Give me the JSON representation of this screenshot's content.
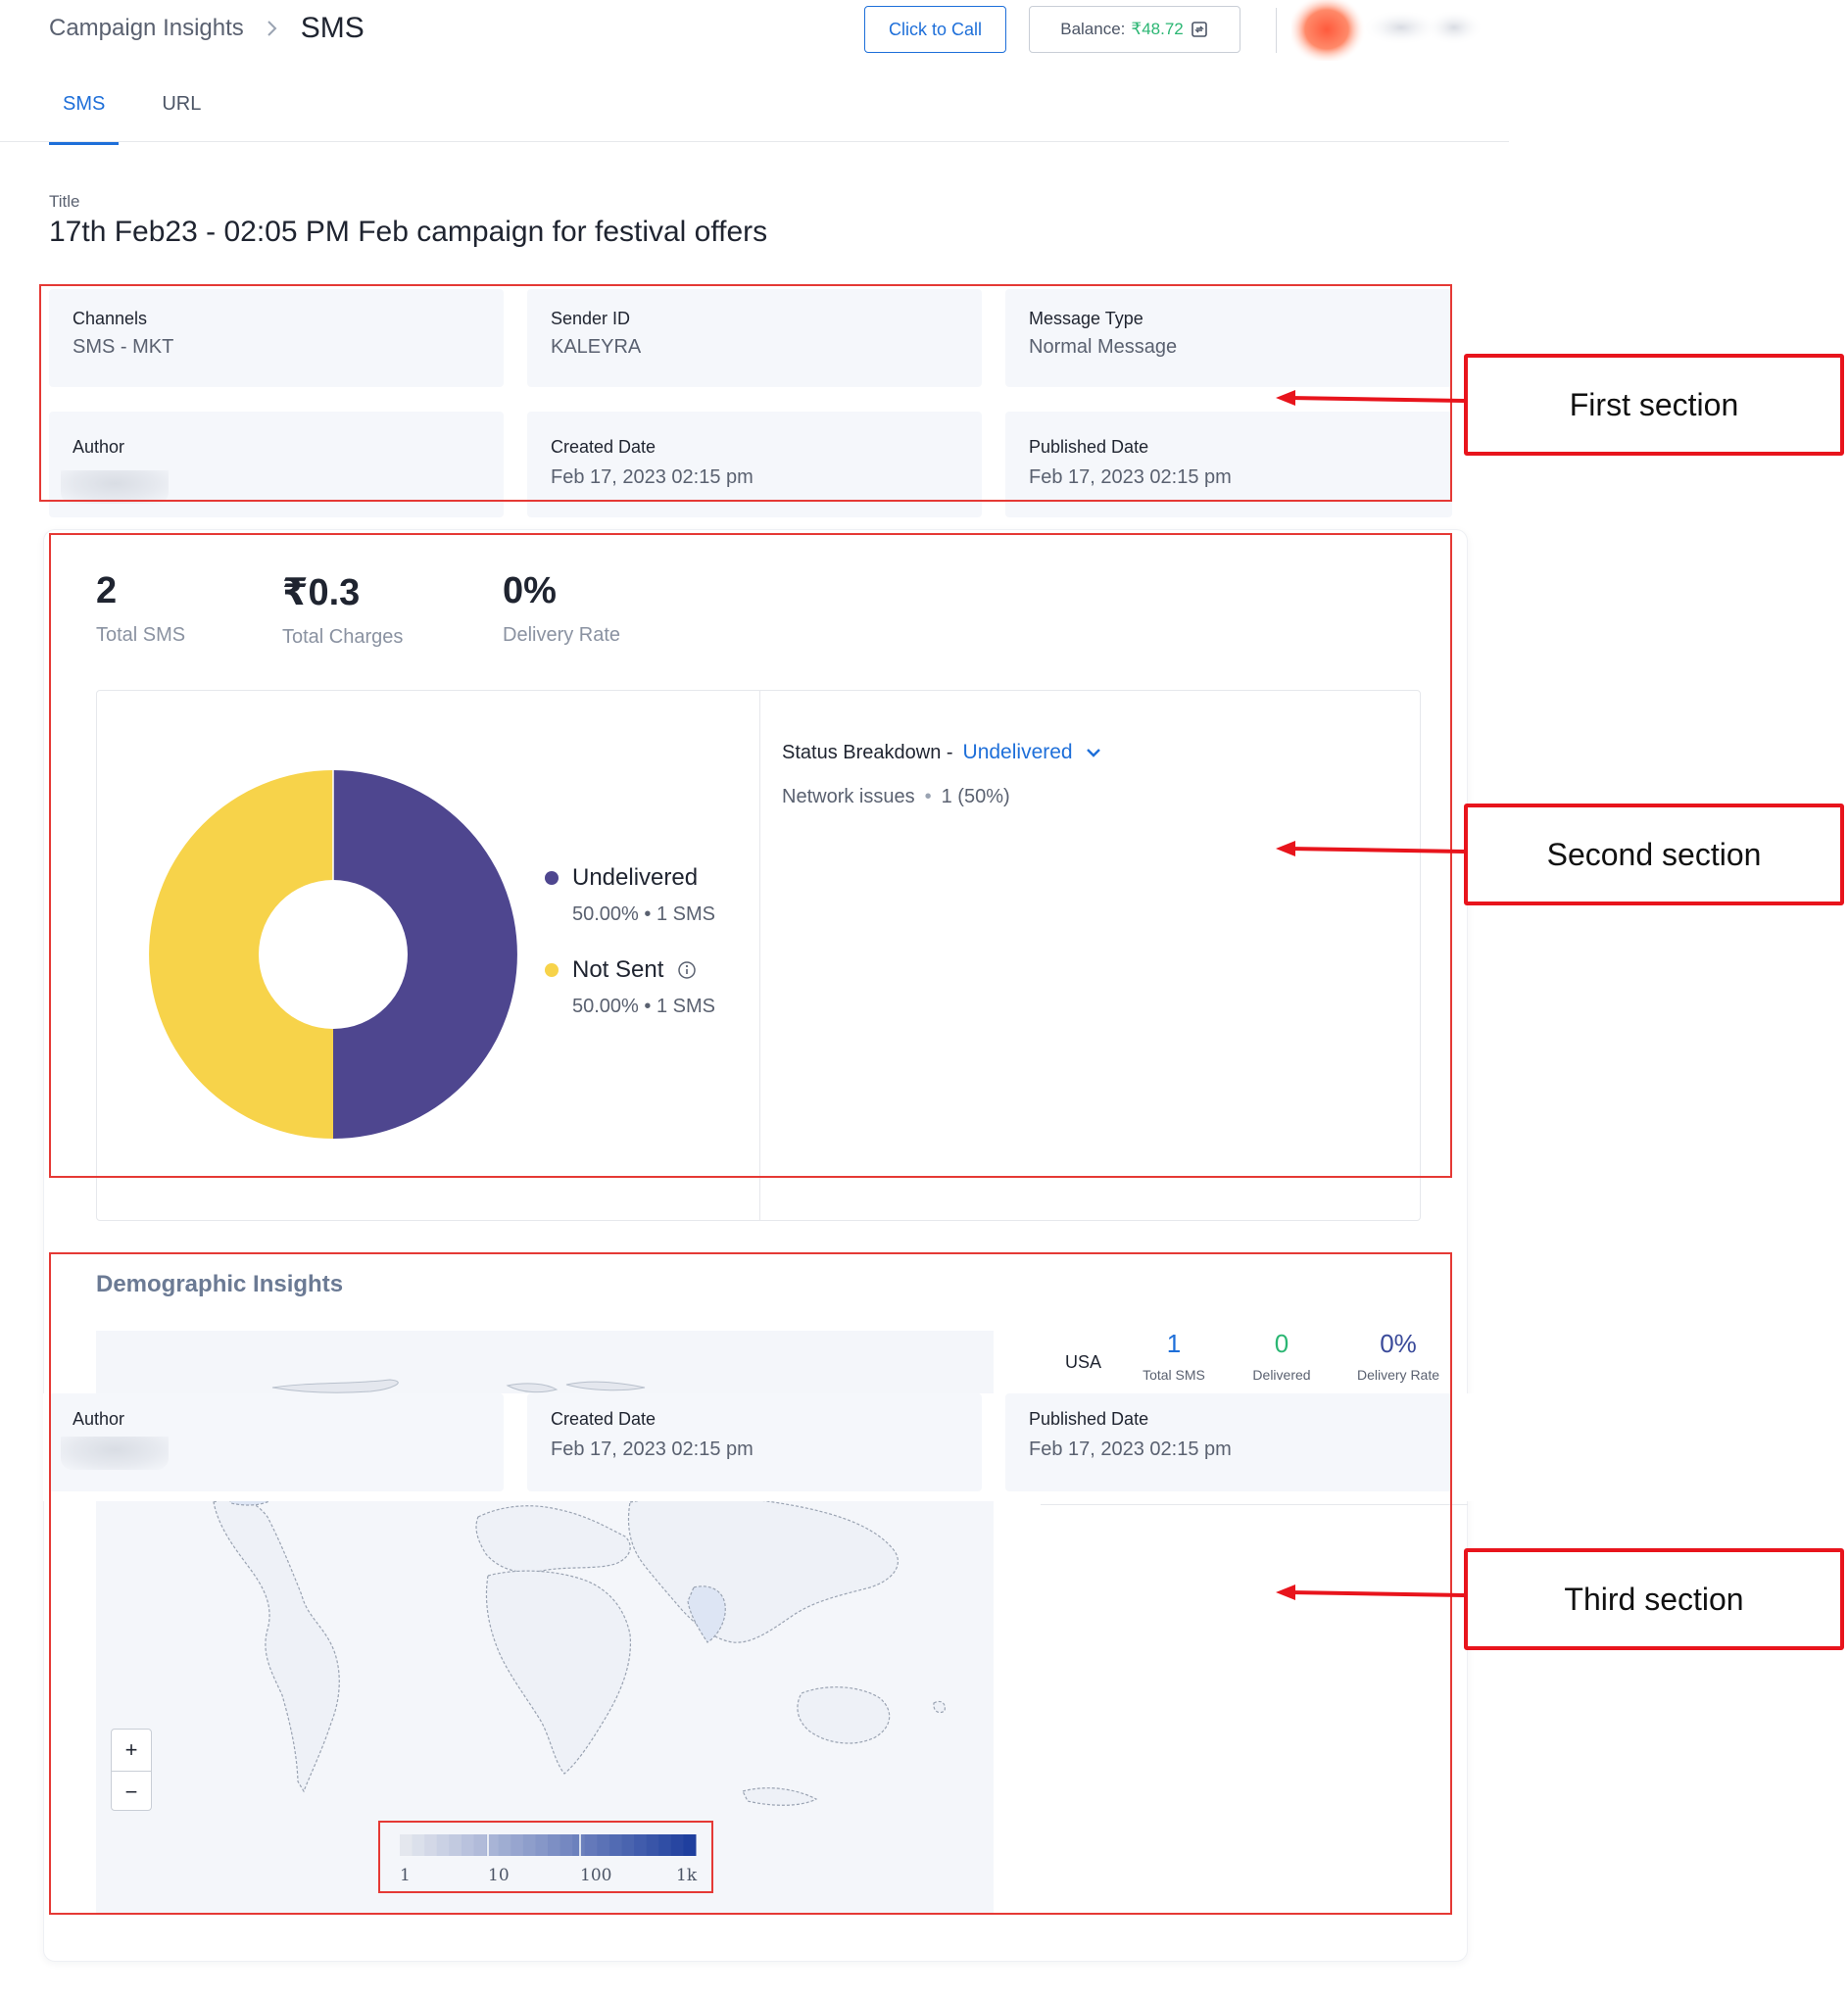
{
  "header": {
    "breadcrumb_parent": "Campaign Insights",
    "breadcrumb_current": "SMS",
    "click_to_call": "Click to Call",
    "balance_label": "Balance:",
    "balance_amount": "₹48.72"
  },
  "tabs": [
    {
      "label": "SMS",
      "active": true
    },
    {
      "label": "URL",
      "active": false
    }
  ],
  "title": {
    "label": "Title",
    "text": "17th Feb23 - 02:05 PM Feb campaign for festival offers"
  },
  "details": {
    "channels": {
      "label": "Channels",
      "value": "SMS - MKT"
    },
    "sender_id": {
      "label": "Sender ID",
      "value": "KALEYRA"
    },
    "message_type": {
      "label": "Message Type",
      "value": "Normal Message"
    },
    "author": {
      "label": "Author",
      "value": ""
    },
    "created_date": {
      "label": "Created Date",
      "value": "Feb 17, 2023 02:15 pm"
    },
    "published_date": {
      "label": "Published Date",
      "value": "Feb 17, 2023 02:15 pm"
    }
  },
  "stats": [
    {
      "value": "2",
      "caption": "Total SMS"
    },
    {
      "value": "₹0.3",
      "caption": "Total Charges"
    },
    {
      "value": "0%",
      "caption": "Delivery Rate"
    }
  ],
  "chart_data": {
    "type": "pie",
    "donut": true,
    "categories": [
      "Undelivered",
      "Not Sent"
    ],
    "values": [
      1,
      1
    ],
    "percent_labels": [
      "50.00%",
      "50.00%"
    ],
    "count_labels": [
      "1 SMS",
      "1 SMS"
    ],
    "colors": [
      "#4e468f",
      "#f7d34a"
    ],
    "legend": "right",
    "title": ""
  },
  "status_breakdown": {
    "label": "Status Breakdown -",
    "selected": "Undelivered",
    "items": [
      {
        "reason": "Network issues",
        "value": "1 (50%)"
      }
    ]
  },
  "demographic": {
    "title": "Demographic Insights",
    "country": "USA",
    "total_sms": {
      "value": "1",
      "caption": "Total SMS",
      "color": "#1e6fd9"
    },
    "delivered": {
      "value": "0",
      "caption": "Delivered",
      "color": "#2bb673"
    },
    "delivery_rate": {
      "value": "0%",
      "caption": "Delivery Rate",
      "color": "#3a4a9a"
    },
    "zoom_in": "+",
    "zoom_out": "−",
    "scale_ticks": [
      "1",
      "10",
      "100",
      "1k"
    ],
    "scale_colors": [
      "#e4e7ee",
      "#1f3f9e"
    ]
  },
  "annotations": {
    "first": "First section",
    "second": "Second section",
    "third": "Third section",
    "color": "#e8141c"
  }
}
